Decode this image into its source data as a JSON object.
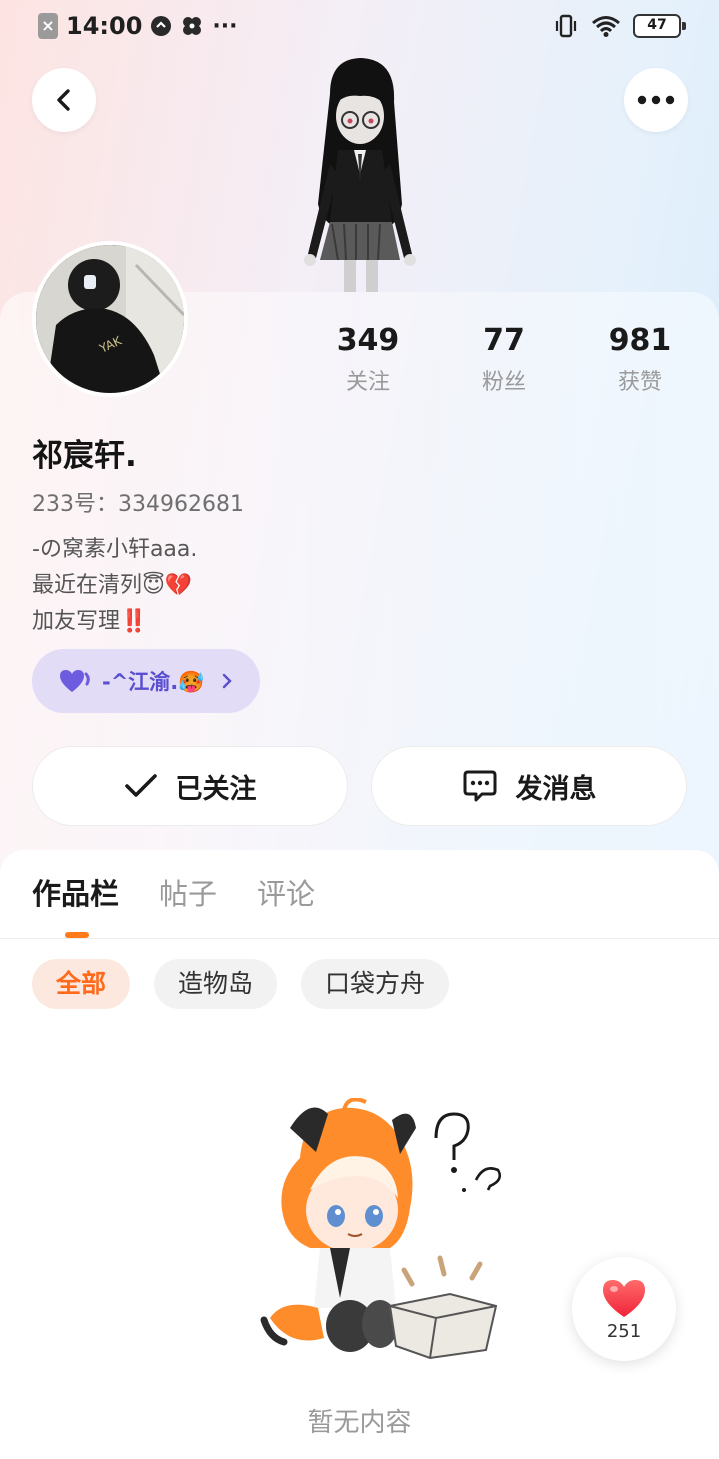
{
  "status_bar": {
    "time": "14:00",
    "battery": "47",
    "sim_icon": "x-icon",
    "dots": "···"
  },
  "header": {
    "back_icon": "chevron-left-icon",
    "more_icon": "more-dots-icon"
  },
  "stats": [
    {
      "value": "349",
      "label": "关注"
    },
    {
      "value": "77",
      "label": "粉丝"
    },
    {
      "value": "981",
      "label": "获赞"
    }
  ],
  "profile": {
    "username": "祁宸轩.",
    "uid": "233号：334962681",
    "bio": [
      "-の窝素小轩aaa.",
      "最近在清列😇💔",
      "加友写理‼️"
    ]
  },
  "friend_chip": {
    "name": "-^江渝.🥵",
    "icon": "heart-icon"
  },
  "actions": {
    "follow_label": "已关注",
    "message_label": "发消息"
  },
  "tabs": [
    "作品栏",
    "帖子",
    "评论"
  ],
  "filters": [
    "全部",
    "造物岛",
    "口袋方舟"
  ],
  "empty": {
    "text": "暂无内容"
  },
  "like_fab": {
    "count": "251"
  },
  "colors": {
    "accent": "#ff7a1a",
    "chip_bg": "#e2dcf7",
    "chip_text": "#5a4fcf",
    "heart": "#ff3b4e"
  }
}
